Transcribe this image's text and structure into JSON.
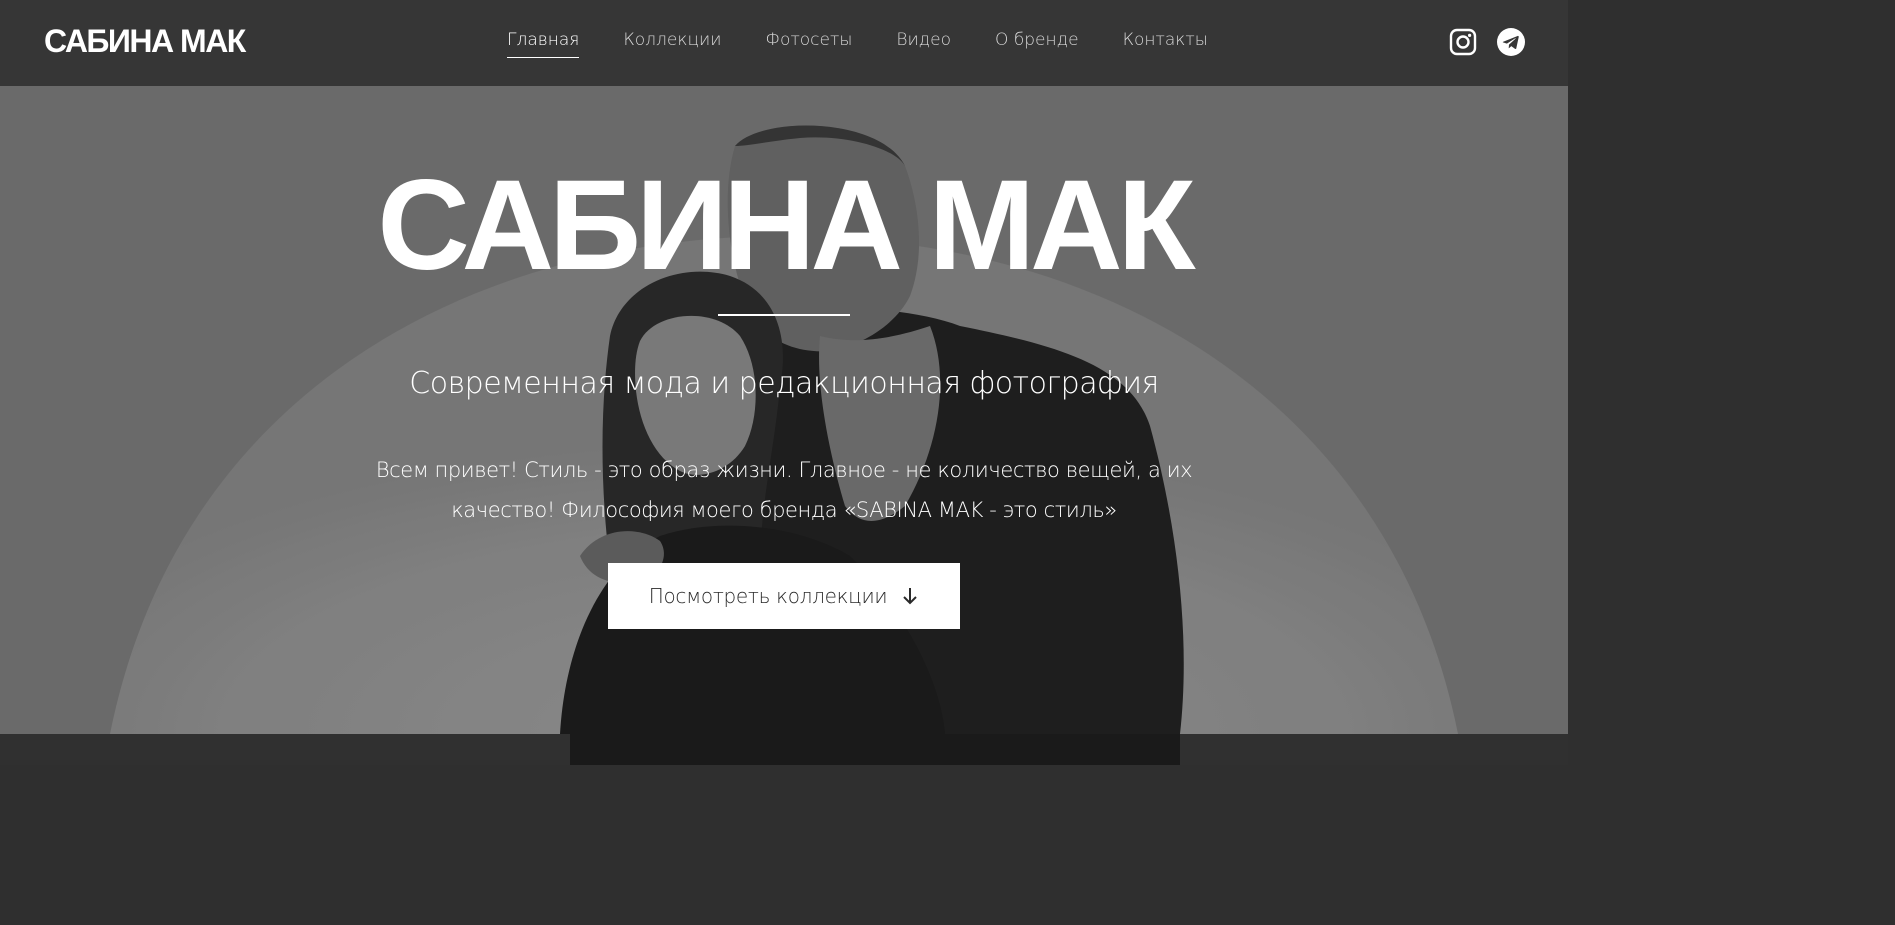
{
  "header": {
    "logo": "САБИНА МАК",
    "nav": [
      {
        "label": "Главная",
        "active": true
      },
      {
        "label": "Коллекции",
        "active": false
      },
      {
        "label": "Фотосеты",
        "active": false
      },
      {
        "label": "Видео",
        "active": false
      },
      {
        "label": "О бренде",
        "active": false
      },
      {
        "label": "Контакты",
        "active": false
      }
    ],
    "social": [
      {
        "icon": "instagram-icon"
      },
      {
        "icon": "telegram-icon"
      }
    ]
  },
  "hero": {
    "title": "САБИНА МАК",
    "subtitle": "Современная мода и редакционная фотография",
    "text": "Всем привет! Стиль - это образ жизни. Главное - не количество вещей, а их качество! Философия моего бренда «SABINA MAK - это стиль»",
    "button_label": "Посмотреть коллекции",
    "button_icon": "arrow-down-icon"
  },
  "colors": {
    "navbar_bg": "#363636",
    "button_bg": "#ffffff",
    "text_light": "#ffffff",
    "nav_text": "#d6d6d6"
  }
}
